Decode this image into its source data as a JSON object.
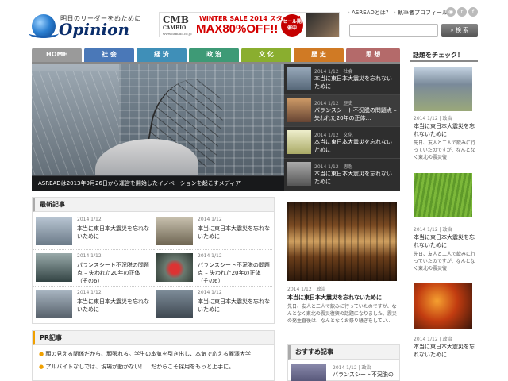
{
  "site": {
    "tagline": "明日のリーダーをめために",
    "logo": "Opinion"
  },
  "ad": {
    "brand_mark": "CMB",
    "brand_name": "CAMBIO",
    "brand_url": "www.cambio.co.jp",
    "title": "WINTER SALE 2014 スタート!!",
    "sale": "MAX80%OFF!!",
    "badge": "セール開催中"
  },
  "topnav": {
    "about": "ASREADとは？",
    "writers": "執筆者プロフィール"
  },
  "search": {
    "placeholder": "",
    "button": "検 索"
  },
  "tabs": [
    {
      "label": "HOME",
      "color": "#9a9a9a"
    },
    {
      "label": "社 会",
      "color": "#4a78b8"
    },
    {
      "label": "経 済",
      "color": "#3f8fb8"
    },
    {
      "label": "政 治",
      "color": "#3e9a76"
    },
    {
      "label": "文 化",
      "color": "#8aae2f"
    },
    {
      "label": "歴 史",
      "color": "#d07a24"
    },
    {
      "label": "思 想",
      "color": "#b46a6a"
    }
  ],
  "hero": {
    "caption": "ASREADは2013年9月26日から運営を開始したイノベーションを起こすメディア",
    "items": [
      {
        "meta": "2014 1/12 | 社会",
        "title": "本当に東日本大震災を忘れないために"
      },
      {
        "meta": "2014 1/12 | 歴史",
        "title": "バランスシート不況脱の問題点 – 失われた20年の正体…"
      },
      {
        "meta": "2014 1/12 | 文化",
        "title": "本当に東日本大震災を忘れないために"
      },
      {
        "meta": "2014 1/12 | 思想",
        "title": "本当に東日本大震災を忘れないために"
      }
    ]
  },
  "latest": {
    "heading": "最新記事",
    "cards": [
      {
        "meta": "2014 1/12",
        "title": "本当に東日本大震災を忘れないために"
      },
      {
        "meta": "2014 1/12",
        "title": "本当に東日本大震災を忘れないために"
      },
      {
        "meta": "2014 1/12",
        "title": "バランスシート不況脱の問題点 – 失われた20年の正体（その6）"
      },
      {
        "meta": "2014 1/12",
        "title": "バランスシート不況脱の問題点 – 失われた20年の正体（その6）"
      },
      {
        "meta": "2014 1/12",
        "title": "本当に東日本大震災を忘れないために"
      },
      {
        "meta": "2014 1/12",
        "title": "本当に東日本大震災を忘れないために"
      }
    ]
  },
  "feature": {
    "meta": "2014 1/12 | 政治",
    "title": "本当に東日本大震災を忘れないために",
    "text": "先日、友人と二人で飲みに行っていたのですが、なんとなく東北の震災復興の話題になりました。震災の発生直後は、なんとなくお祭り騒ぎをしてい…"
  },
  "pr": {
    "heading": "PR記事",
    "items": [
      "顔の見える関係だから、頑張れる。学生の本気を引き出し、本気で応える麗澤大学",
      "アルバイトなしでは、現場が動かない！　だからこそ採用をもっと上手に。"
    ]
  },
  "recommended": {
    "heading": "おすすめ記事",
    "meta": "2014 1/12 | 政治",
    "title": "バランスシート不況脱の"
  },
  "sidebar": {
    "heading": "話題をチェック！",
    "items": [
      {
        "meta": "2014 1/12 | 政治",
        "title": "本当に東日本大震災を忘れないために",
        "text": "先日、友人と二人で飲みに行っていたのですが、なんとなく東北の震災復"
      },
      {
        "meta": "2014 1/12 | 政治",
        "title": "本当に東日本大震災を忘れないために",
        "text": "先日、友人と二人で飲みに行っていたのですが、なんとなく東北の震災復"
      },
      {
        "meta": "2014 1/12 | 政治",
        "title": "本当に東日本大震災を忘れないために",
        "text": ""
      }
    ]
  }
}
